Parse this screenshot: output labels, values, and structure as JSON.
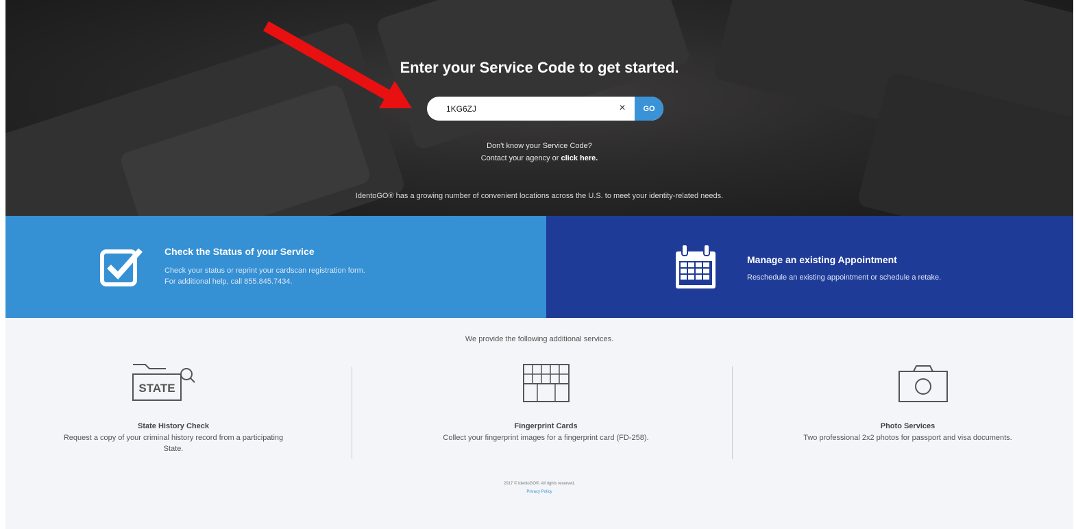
{
  "hero": {
    "title": "Enter your Service Code to get started.",
    "search": {
      "value": "1KG6ZJ",
      "placeholder": ""
    },
    "clear_label": "×",
    "go_label": "GO",
    "hint_line1": "Don't know your Service Code?",
    "hint_line2_prefix": "Contact your agency or ",
    "hint_link": "click here.",
    "locations_text": "IdentoGO® has a growing number of convenient locations across the U.S. to meet your identity-related needs."
  },
  "panels": {
    "status": {
      "title": "Check the Status of your Service",
      "line1": "Check your status or reprint your cardscan registration form.",
      "line2": "For additional help, call 855.845.7434."
    },
    "appointment": {
      "title": "Manage an existing Appointment",
      "line1": "Reschedule an existing appointment or schedule a retake."
    }
  },
  "services": {
    "intro": "We provide the following additional services.",
    "items": [
      {
        "icon": "state-folder-search-icon",
        "icon_text": "STATE",
        "title": "State History Check",
        "desc_line1": "Request a copy of your criminal history record from a participating",
        "desc_line2": "State."
      },
      {
        "icon": "fingerprint-card-icon",
        "title": "Fingerprint Cards",
        "desc_line1": "Collect your fingerprint images for a fingerprint card (FD-258)."
      },
      {
        "icon": "camera-icon",
        "title": "Photo Services",
        "desc_line1": "Two professional 2x2 photos for passport and visa documents."
      }
    ]
  },
  "footer": {
    "copyright": "2017 © IdentoGO®. All rights reserved.",
    "privacy": "Privacy Policy"
  },
  "colors": {
    "accent_blue": "#3590d4",
    "dark_blue": "#1f3b98",
    "arrow_red": "#e81010"
  }
}
